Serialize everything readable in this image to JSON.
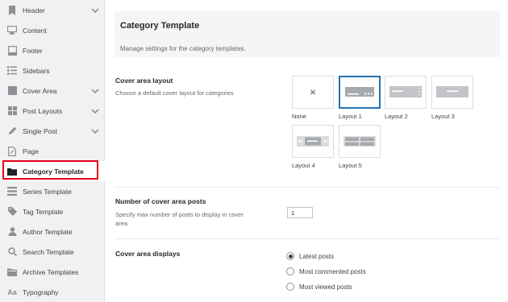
{
  "sidebar": {
    "items": [
      {
        "label": "Header",
        "icon": "bookmark-icon",
        "has_chevron": true
      },
      {
        "label": "Content",
        "icon": "monitor-icon",
        "has_chevron": false
      },
      {
        "label": "Footer",
        "icon": "footer-icon",
        "has_chevron": false
      },
      {
        "label": "Sidebars",
        "icon": "list-icon",
        "has_chevron": false
      },
      {
        "label": "Cover Area",
        "icon": "cover-icon",
        "has_chevron": true
      },
      {
        "label": "Post Layouts",
        "icon": "grid-icon",
        "has_chevron": true
      },
      {
        "label": "Single Post",
        "icon": "pencil-icon",
        "has_chevron": true
      },
      {
        "label": "Page",
        "icon": "page-icon",
        "has_chevron": false
      },
      {
        "label": "Category Template",
        "icon": "folder-icon",
        "has_chevron": false
      },
      {
        "label": "Series Template",
        "icon": "series-icon",
        "has_chevron": false
      },
      {
        "label": "Tag Template",
        "icon": "tag-icon",
        "has_chevron": false
      },
      {
        "label": "Author Template",
        "icon": "user-icon",
        "has_chevron": false
      },
      {
        "label": "Search Template",
        "icon": "search-icon",
        "has_chevron": false
      },
      {
        "label": "Archive Templates",
        "icon": "archive-icon",
        "has_chevron": false
      },
      {
        "label": "Typography",
        "icon": "typography-icon",
        "has_chevron": false
      }
    ],
    "active_index": 8
  },
  "header": {
    "title": "Category Template",
    "description": "Manage settings for the category templates."
  },
  "cover_layout": {
    "label": "Cover area layout",
    "help": "Choose a default cover layout for categories",
    "options": [
      "None",
      "Layout 1",
      "Layout 2",
      "Layout 3",
      "Layout 4",
      "Layout 5"
    ],
    "selected": "Layout 1"
  },
  "post_count": {
    "label": "Number of cover area posts",
    "help": "Specify max number of posts to display in cover area",
    "value": "1"
  },
  "cover_displays": {
    "label": "Cover area displays",
    "options": [
      "Latest posts",
      "Most commented posts",
      "Most viewed posts"
    ],
    "selected": "Latest posts"
  },
  "colors": {
    "accent": "#2271b1",
    "highlight": "#e2001a"
  }
}
